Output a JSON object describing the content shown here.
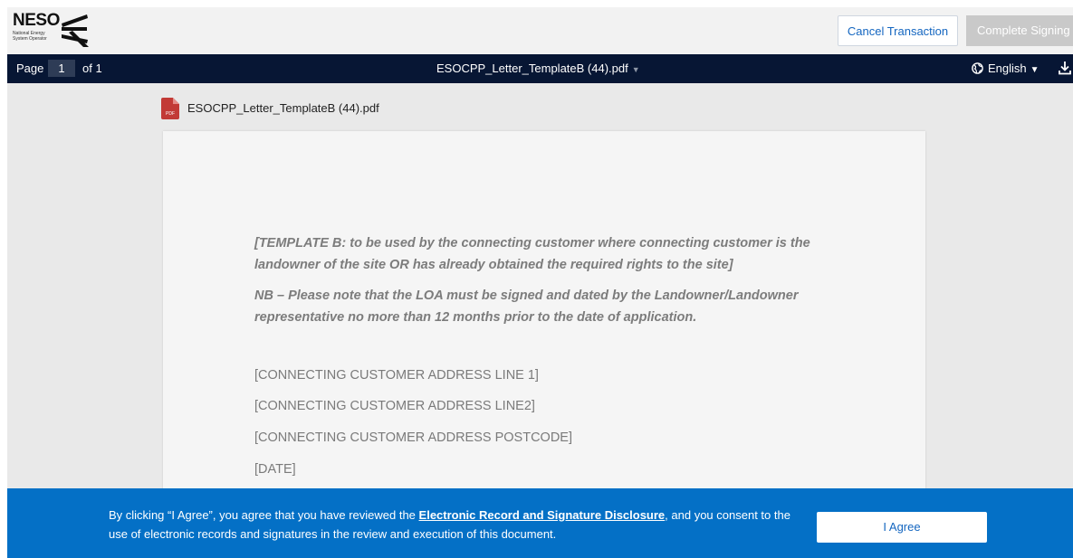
{
  "header": {
    "logo": {
      "wordmark": "NESO",
      "subtitle_line1": "National Energy",
      "subtitle_line2": "System Operator"
    },
    "cancel_label": "Cancel Transaction",
    "complete_label": "Complete Signing"
  },
  "toolbar": {
    "page_label": "Page",
    "page_number": "1",
    "page_of": "of 1",
    "document_title": "ESOCPP_Letter_TemplateB (44).pdf",
    "language": "English"
  },
  "viewer": {
    "file_name": "ESOCPP_Letter_TemplateB (44).pdf",
    "pdf_badge": "PDF",
    "document": {
      "template_note_line1": "[TEMPLATE B: to be used by the connecting customer where connecting customer is the",
      "template_note_line2": "landowner of the site OR has already obtained the required rights to the site]",
      "nb_line1": "NB – Please note that the LOA must be signed and dated by the Landowner/Landowner",
      "nb_line2": "representative no more than 12 months prior to the date of application.",
      "address_line1": "[CONNECTING CUSTOMER ADDRESS LINE 1]",
      "address_line2": "[CONNECTING CUSTOMER ADDRESS LINE2]",
      "address_postcode": "[CONNECTING CUSTOMER ADDRESS POSTCODE]",
      "date": "[DATE]"
    }
  },
  "consent": {
    "text_before": "By clicking “I Agree”, you agree that you have reviewed the ",
    "link_text": "Electronic Record and Signature Disclosure",
    "text_after": ", and you consent to the use of electronic records and signatures in the review and execution of this document.",
    "agree_label": "I Agree"
  },
  "colors": {
    "toolbar_bg": "#071634",
    "banner_bg": "#0470c6",
    "link_blue": "#1466c0",
    "disabled_button": "#c9c9c9"
  },
  "icons": [
    "neso-logo-mark",
    "globe-icon",
    "caret-down-icon",
    "download-icon",
    "pdf-file-icon"
  ]
}
